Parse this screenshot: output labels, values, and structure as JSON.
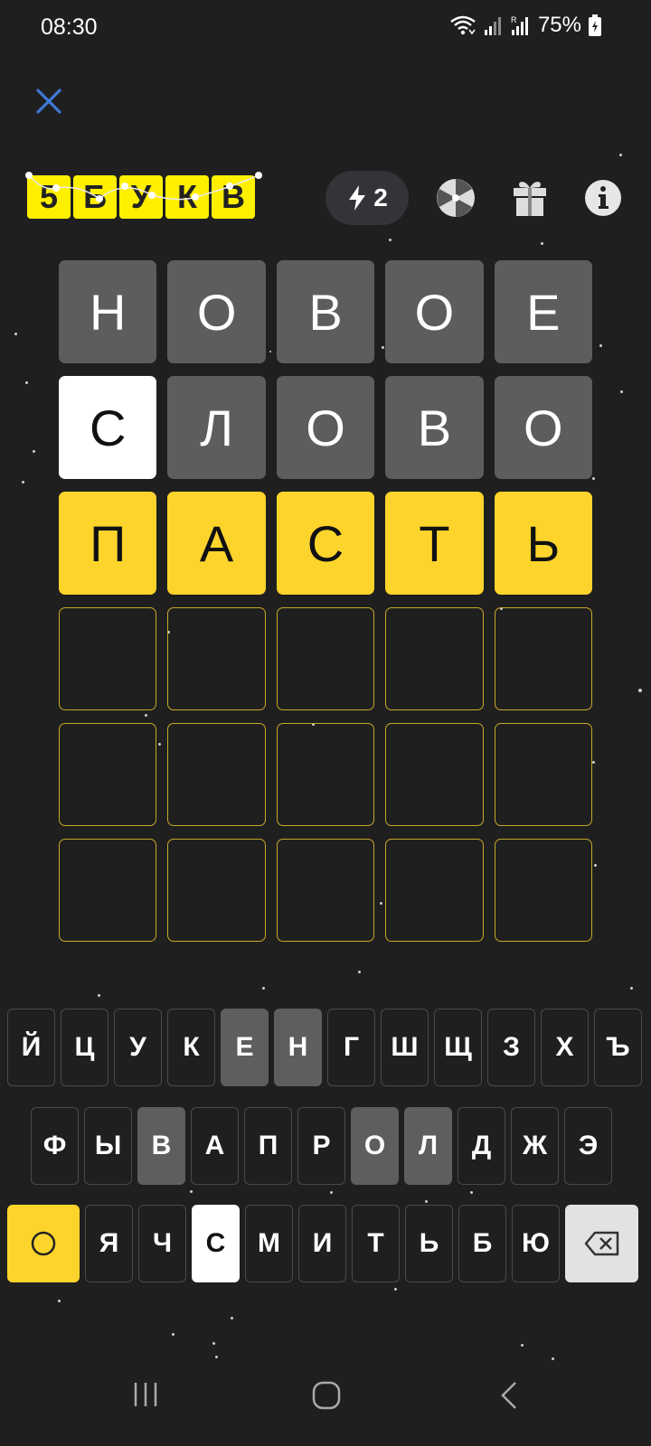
{
  "status_bar": {
    "time": "08:30",
    "battery": "75%"
  },
  "logo": {
    "letters": [
      "5",
      "Б",
      "У",
      "К",
      "В"
    ]
  },
  "hints": {
    "count": "2"
  },
  "board": {
    "rows": [
      [
        {
          "l": "Н",
          "s": "absent"
        },
        {
          "l": "О",
          "s": "absent"
        },
        {
          "l": "В",
          "s": "absent"
        },
        {
          "l": "О",
          "s": "absent"
        },
        {
          "l": "Е",
          "s": "absent"
        }
      ],
      [
        {
          "l": "С",
          "s": "correct"
        },
        {
          "l": "Л",
          "s": "absent"
        },
        {
          "l": "О",
          "s": "absent"
        },
        {
          "l": "В",
          "s": "absent"
        },
        {
          "l": "О",
          "s": "absent"
        }
      ],
      [
        {
          "l": "П",
          "s": "present"
        },
        {
          "l": "А",
          "s": "present"
        },
        {
          "l": "С",
          "s": "present"
        },
        {
          "l": "Т",
          "s": "present"
        },
        {
          "l": "Ь",
          "s": "present"
        }
      ],
      [
        {
          "l": "",
          "s": "empty"
        },
        {
          "l": "",
          "s": "empty"
        },
        {
          "l": "",
          "s": "empty"
        },
        {
          "l": "",
          "s": "empty"
        },
        {
          "l": "",
          "s": "empty"
        }
      ],
      [
        {
          "l": "",
          "s": "empty"
        },
        {
          "l": "",
          "s": "empty"
        },
        {
          "l": "",
          "s": "empty"
        },
        {
          "l": "",
          "s": "empty"
        },
        {
          "l": "",
          "s": "empty"
        }
      ],
      [
        {
          "l": "",
          "s": "empty"
        },
        {
          "l": "",
          "s": "empty"
        },
        {
          "l": "",
          "s": "empty"
        },
        {
          "l": "",
          "s": "empty"
        },
        {
          "l": "",
          "s": "empty"
        }
      ]
    ]
  },
  "keyboard": {
    "rows": [
      [
        {
          "k": "Й"
        },
        {
          "k": "Ц"
        },
        {
          "k": "У"
        },
        {
          "k": "К"
        },
        {
          "k": "Е",
          "s": "used"
        },
        {
          "k": "Н",
          "s": "used"
        },
        {
          "k": "Г"
        },
        {
          "k": "Ш"
        },
        {
          "k": "Щ"
        },
        {
          "k": "З"
        },
        {
          "k": "Х"
        },
        {
          "k": "Ъ"
        }
      ],
      [
        {
          "k": "Ф"
        },
        {
          "k": "Ы"
        },
        {
          "k": "В",
          "s": "used"
        },
        {
          "k": "А"
        },
        {
          "k": "П"
        },
        {
          "k": "Р"
        },
        {
          "k": "О",
          "s": "used"
        },
        {
          "k": "Л",
          "s": "used"
        },
        {
          "k": "Д"
        },
        {
          "k": "Ж"
        },
        {
          "k": "Э"
        }
      ],
      [
        {
          "k": "",
          "s": "enter"
        },
        {
          "k": "Я"
        },
        {
          "k": "Ч"
        },
        {
          "k": "С",
          "s": "correct"
        },
        {
          "k": "М"
        },
        {
          "k": "И"
        },
        {
          "k": "Т"
        },
        {
          "k": "Ь"
        },
        {
          "k": "Б"
        },
        {
          "k": "Ю"
        },
        {
          "k": "",
          "s": "backspace"
        }
      ]
    ]
  },
  "colors": {
    "background": "#1f1f20",
    "absent": "#5d5d5e",
    "correct": "#ffffff",
    "present": "#fdd42b",
    "empty_border": "#c9a927",
    "close_icon": "#3d7ad6"
  },
  "icons": {
    "close": "close-icon",
    "hint": "lightning-icon",
    "wheel": "wheel-icon",
    "gift": "gift-icon",
    "info": "info-icon",
    "enter": "circle-icon",
    "backspace": "backspace-icon"
  }
}
